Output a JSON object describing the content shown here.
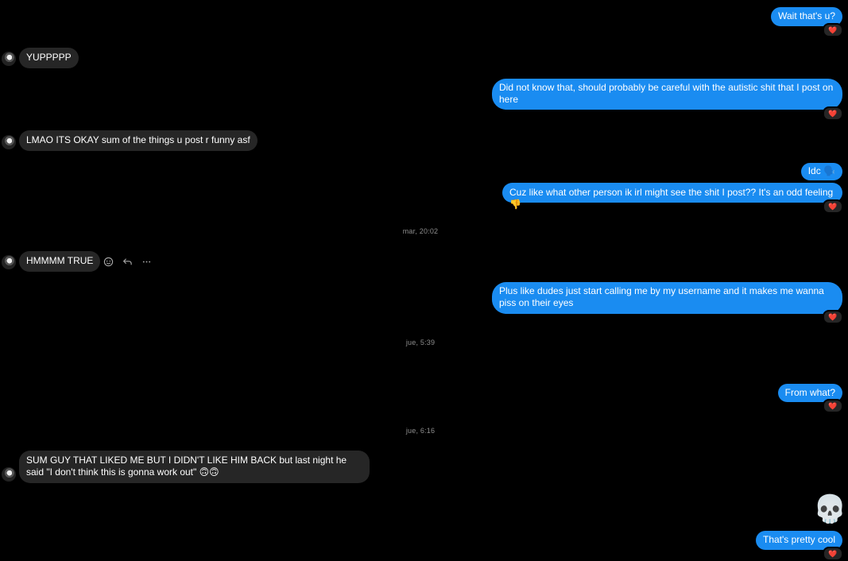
{
  "messages": [
    {
      "id": "m1",
      "text": "Wait that's u?",
      "reaction": "❤️"
    },
    {
      "id": "m2",
      "text": "YUPPPPP"
    },
    {
      "id": "m3",
      "text": "Did not know that, should probably be careful with the autistic shit that I post on here",
      "reaction": "❤️"
    },
    {
      "id": "m4",
      "text": "LMAO ITS OKAY sum of the things u post r funny asf"
    },
    {
      "id": "m5",
      "text": "Idc 🗣️"
    },
    {
      "id": "m6",
      "text": "Cuz like what other person ik irl might see the shit I post?? It's an odd feeling 👎",
      "reaction": "❤️"
    },
    {
      "id": "m7",
      "text": "HMMMM TRUE"
    },
    {
      "id": "m8",
      "text": "Plus like dudes just start calling me by my username and it makes me wanna piss on their eyes",
      "reaction": "❤️"
    },
    {
      "id": "m9",
      "text": "From what?",
      "reaction": "❤️"
    },
    {
      "id": "m10",
      "text": "SUM GUY THAT LIKED ME BUT I DIDN'T LIKE HIM BACK but last night he said \"I don't think this is gonna work out\" 🙃🙃"
    },
    {
      "id": "m11",
      "text": "💀"
    },
    {
      "id": "m12",
      "text": "That's pretty cool",
      "reaction": "❤️"
    }
  ],
  "timestamps": [
    "mar, 20:02",
    "jue, 5:39",
    "jue, 6:16"
  ],
  "hover_actions": {
    "react_icon": "smile-icon",
    "reply_icon": "reply-icon",
    "more_icon": "more-icon"
  }
}
